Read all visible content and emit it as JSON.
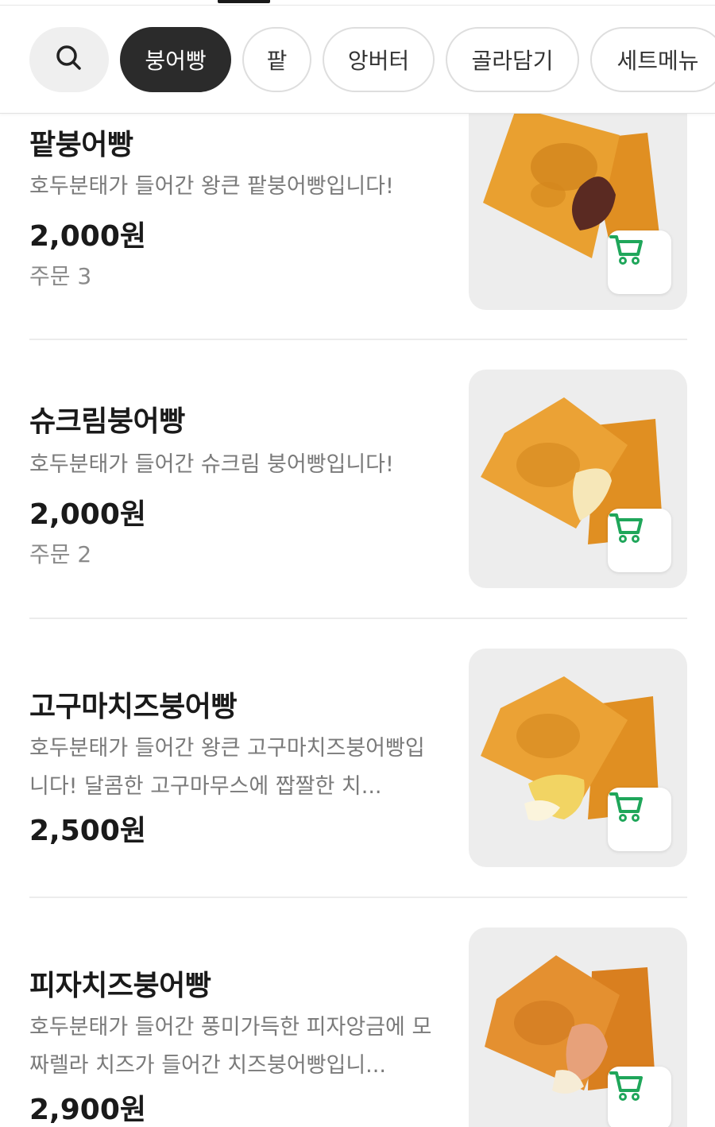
{
  "categories": {
    "search_icon": "search-icon",
    "chips": [
      {
        "label": "붕어빵",
        "active": true
      },
      {
        "label": "팥",
        "active": false
      },
      {
        "label": "앙버터",
        "active": false
      },
      {
        "label": "골라담기",
        "active": false
      },
      {
        "label": "세트메뉴",
        "active": false
      }
    ]
  },
  "colors": {
    "active_chip": "#2b2b2b",
    "cart_icon": "#1fa65a",
    "bread": "#e39a2a",
    "thumb_bg": "#ededed"
  },
  "menu": {
    "items": [
      {
        "name": "팥붕어빵",
        "description": "호두분태가 들어간 왕큰 팥붕어빵입니다!",
        "price": "2,000원",
        "orders": "주문 3",
        "cart_icon": "cart-icon",
        "filling": "red-bean"
      },
      {
        "name": "슈크림붕어빵",
        "description": "호두분태가 들어간 슈크림 붕어빵입니다!",
        "price": "2,000원",
        "orders": "주문 2",
        "cart_icon": "cart-icon",
        "filling": "custard"
      },
      {
        "name": "고구마치즈붕어빵",
        "description": "호두분태가 들어간 왕큰 고구마치즈붕어빵입니다! 달콤한 고구마무스에 짭짤한 치...",
        "price": "2,500원",
        "orders": "",
        "cart_icon": "cart-icon",
        "filling": "sweet-potato-cheese"
      },
      {
        "name": "피자치즈붕어빵",
        "description": "호두분태가 들어간 풍미가득한 피자앙금에 모짜렐라 치즈가 들어간 치즈붕어빵입니...",
        "price": "2,900원",
        "orders": "",
        "cart_icon": "cart-icon",
        "filling": "pizza-cheese"
      }
    ]
  }
}
